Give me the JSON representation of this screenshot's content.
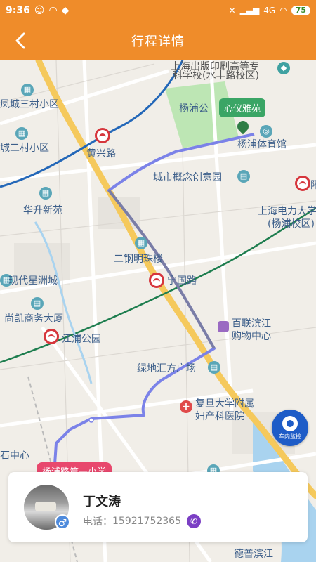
{
  "status_bar": {
    "time": "9:36",
    "network": "4G",
    "battery": "75"
  },
  "header": {
    "title": "行程详情"
  },
  "map": {
    "labels": [
      {
        "text": "上海出版印刷高等专",
        "cls": "dark"
      },
      {
        "text": "科学校(水丰路校区)",
        "cls": "dark"
      },
      {
        "text": "凤城三村小区",
        "cls": ""
      },
      {
        "text": "杨浦公",
        "cls": ""
      },
      {
        "text": "杨浦体育馆",
        "cls": ""
      },
      {
        "text": "黄兴路",
        "cls": ""
      },
      {
        "text": "城二村小区",
        "cls": ""
      },
      {
        "text": "城市概念创意园",
        "cls": ""
      },
      {
        "text": "阳",
        "cls": ""
      },
      {
        "text": "华升新苑",
        "cls": ""
      },
      {
        "text": "上海电力大学",
        "cls": ""
      },
      {
        "text": "(杨浦校区)",
        "cls": ""
      },
      {
        "text": "二钢明珠楼",
        "cls": ""
      },
      {
        "text": "宁国路",
        "cls": ""
      },
      {
        "text": "现代星洲城",
        "cls": ""
      },
      {
        "text": "尚凯商务大厦",
        "cls": ""
      },
      {
        "text": "江浦公园",
        "cls": ""
      },
      {
        "text": "百联滨江",
        "cls": ""
      },
      {
        "text": "购物中心",
        "cls": ""
      },
      {
        "text": "绿地汇方广场",
        "cls": ""
      },
      {
        "text": "复旦大学附属",
        "cls": ""
      },
      {
        "text": "妇产科医院",
        "cls": ""
      },
      {
        "text": "石中心",
        "cls": ""
      },
      {
        "text": "德普滨江",
        "cls": ""
      }
    ],
    "park_tag": "心仪雅苑",
    "school_tag": "杨浦路第一小学",
    "monitor_label": "车内监控"
  },
  "driver": {
    "name": "丁文涛",
    "phone_label": "电话：",
    "phone": "15921752365",
    "gender_symbol": "♂"
  },
  "colors": {
    "accent": "#ef8c2a",
    "route": "#7b82e8",
    "metro_red": "#d6363c"
  }
}
